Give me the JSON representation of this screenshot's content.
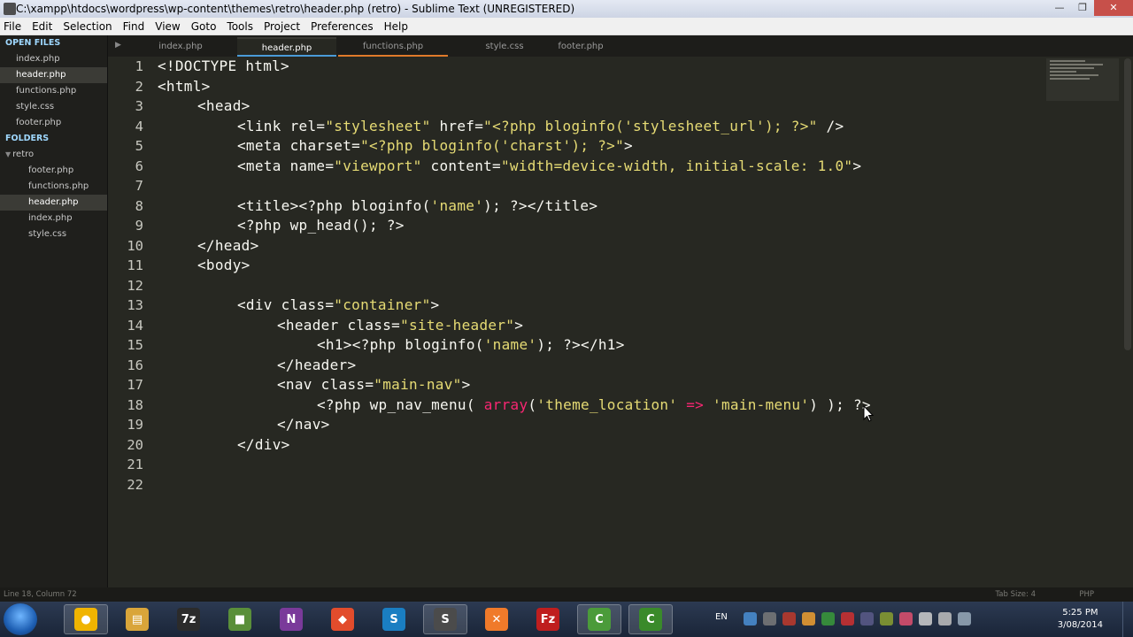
{
  "window": {
    "title": "C:\\xampp\\htdocs\\wordpress\\wp-content\\themes\\retro\\header.php (retro) - Sublime Text (UNREGISTERED)",
    "minimize_glyph": "—",
    "maximize_glyph": "❐",
    "close_glyph": "✕"
  },
  "menu": [
    "File",
    "Edit",
    "Selection",
    "Find",
    "View",
    "Goto",
    "Tools",
    "Project",
    "Preferences",
    "Help"
  ],
  "sidebar": {
    "open_files_heading": "OPEN FILES",
    "open_files": [
      "index.php",
      "header.php",
      "functions.php",
      "style.css",
      "footer.php"
    ],
    "folders_heading": "FOLDERS",
    "folder_name": "retro",
    "folder_files": [
      "footer.php",
      "functions.php",
      "header.php",
      "index.php",
      "style.css"
    ]
  },
  "tabs": [
    "index.php",
    "header.php",
    "functions.php",
    "style.css",
    "footer.php"
  ],
  "tab_scroll_glyph": "▶",
  "line_numbers": [
    "1",
    "2",
    "3",
    "4",
    "5",
    "6",
    "7",
    "8",
    "9",
    "10",
    "11",
    "12",
    "13",
    "14",
    "15",
    "16",
    "17",
    "18",
    "19",
    "20",
    "21",
    "22"
  ],
  "code": {
    "l1": "<!DOCTYPE html>",
    "l2": "<html>",
    "l3": "<head>",
    "l4a": "<link rel=",
    "l4b": "\"stylesheet\"",
    "l4c": " href=",
    "l4d": "\"<?php bloginfo('stylesheet_url'); ?>\"",
    "l4e": " />",
    "l5a": "<meta charset=",
    "l5b": "\"<?php bloginfo('charst'); ?>\"",
    "l5c": ">",
    "l6a": "<meta name=",
    "l6b": "\"viewport\"",
    "l6c": " content=",
    "l6d": "\"width=device-width, initial-scale: 1.0\"",
    "l6e": ">",
    "l8a": "<title><?php bloginfo(",
    "l8b": "'name'",
    "l8c": "); ?></title>",
    "l9": "<?php wp_head(); ?>",
    "l10": "</head>",
    "l11": "<body>",
    "l13a": "<div class=",
    "l13b": "\"container\"",
    "l13c": ">",
    "l14a": "<header class=",
    "l14b": "\"site-header\"",
    "l14c": ">",
    "l15a": "<h1><?php bloginfo(",
    "l15b": "'name'",
    "l15c": "); ?></h1>",
    "l16": "</header>",
    "l17a": "<nav class=",
    "l17b": "\"main-nav\"",
    "l17c": ">",
    "l18a": "<?php wp_nav_menu( ",
    "l18b": "array",
    "l18c": "(",
    "l18d": "'theme_location'",
    "l18e": " => ",
    "l18f": "'main-menu'",
    "l18g": ") ); ?>",
    "l19": "</nav>",
    "l20": "</div>"
  },
  "status": {
    "position": "Line 18, Column 72",
    "tab_size": "Tab Size: 4",
    "syntax": "PHP"
  },
  "taskbar": {
    "apps": [
      {
        "name": "chrome",
        "color": "#f0b400",
        "glyph": "●"
      },
      {
        "name": "explorer",
        "color": "#d9a53a",
        "glyph": "▤"
      },
      {
        "name": "7zip",
        "color": "#2b2b2b",
        "glyph": "7z"
      },
      {
        "name": "minecraft",
        "color": "#5a8f3a",
        "glyph": "■"
      },
      {
        "name": "onenote",
        "color": "#7a3a9a",
        "glyph": "N"
      },
      {
        "name": "git",
        "color": "#e24c2c",
        "glyph": "◆"
      },
      {
        "name": "sourcetree",
        "color": "#1a7ec2",
        "glyph": "S"
      },
      {
        "name": "sublime",
        "color": "#4b4b4b",
        "glyph": "S"
      },
      {
        "name": "xampp",
        "color": "#f07a2a",
        "glyph": "✕"
      },
      {
        "name": "filezilla",
        "color": "#bf1e1e",
        "glyph": "Fz"
      },
      {
        "name": "camtasia-1",
        "color": "#4b9b3a",
        "glyph": "C"
      },
      {
        "name": "camtasia-2",
        "color": "#3a8a2a",
        "glyph": "C"
      }
    ],
    "language": "EN",
    "time": "5:25 PM",
    "date": "3/08/2014"
  },
  "colors": {
    "editor_bg": "#272822",
    "string": "#e6db74",
    "keyword": "#f92672",
    "active_tab_underline": "#4a9bd8",
    "functions_tab_underline": "#e07a2a"
  }
}
